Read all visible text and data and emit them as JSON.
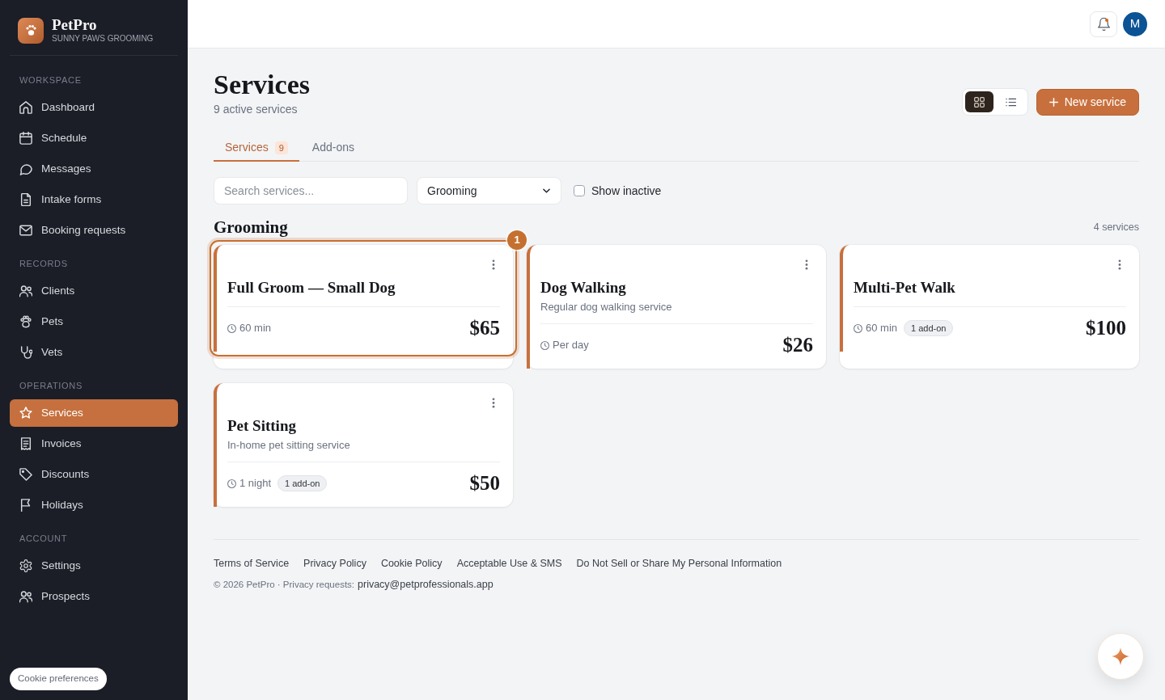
{
  "brand": {
    "name": "PetPro",
    "subtitle": "SUNNY PAWS GROOMING"
  },
  "sidebar": {
    "sections": [
      {
        "label": "WORKSPACE",
        "items": [
          {
            "label": "Dashboard",
            "selected": false
          },
          {
            "label": "Schedule",
            "selected": false
          },
          {
            "label": "Messages",
            "selected": false
          },
          {
            "label": "Intake forms",
            "selected": false
          },
          {
            "label": "Booking requests",
            "selected": false
          }
        ]
      },
      {
        "label": "RECORDS",
        "items": [
          {
            "label": "Clients",
            "selected": false
          },
          {
            "label": "Pets",
            "selected": false
          },
          {
            "label": "Vets",
            "selected": false
          }
        ]
      },
      {
        "label": "OPERATIONS",
        "items": [
          {
            "label": "Services",
            "selected": true
          },
          {
            "label": "Invoices",
            "selected": false
          },
          {
            "label": "Discounts",
            "selected": false
          },
          {
            "label": "Holidays",
            "selected": false
          }
        ]
      },
      {
        "label": "ACCOUNT",
        "items": [
          {
            "label": "Settings",
            "selected": false
          },
          {
            "label": "Prospects",
            "selected": false
          }
        ]
      }
    ],
    "cookie_button": "Cookie preferences"
  },
  "topbar": {
    "notifications": {
      "unread": true
    },
    "avatar": "M"
  },
  "header": {
    "title": "Services",
    "subtitle": "9 active services",
    "view_toggle": [
      {
        "selected": true
      },
      {
        "selected": false
      }
    ],
    "new_button": "New service"
  },
  "tabs": [
    {
      "label": "Services",
      "count": "9",
      "selected": true
    },
    {
      "label": "Add-ons",
      "selected": false
    }
  ],
  "filters": {
    "search": {
      "placeholder": "Search services..."
    },
    "category": "Grooming",
    "show_inactive": {
      "label": "Show inactive",
      "checked": false
    }
  },
  "group": {
    "title": "Grooming",
    "count": "4 services",
    "cards": [
      {
        "title": "Full Groom — Small Dog",
        "duration": "60 min",
        "price": "$65",
        "highlighted": true,
        "highlight_badge": "1"
      },
      {
        "title": "Dog Walking",
        "description": "Regular dog walking service",
        "duration": "Per day",
        "price": "$26",
        "highlighted": false
      },
      {
        "title": "Multi-Pet Walk",
        "duration": "60 min",
        "addon": "1 add-on",
        "price": "$100",
        "highlighted": false
      },
      {
        "title": "Pet Sitting",
        "description": "In-home pet sitting service",
        "duration": "1 night",
        "addon": "1 add-on",
        "price": "$50",
        "highlighted": false
      }
    ]
  },
  "footer": {
    "links": [
      "Terms of Service",
      "Privacy Policy",
      "Cookie Policy",
      "Acceptable Use & SMS",
      "Do Not Sell or Share My Personal Information"
    ],
    "copyright": "© 2026 PetPro · Privacy requests:",
    "email": "privacy@petprofessionals.app"
  }
}
